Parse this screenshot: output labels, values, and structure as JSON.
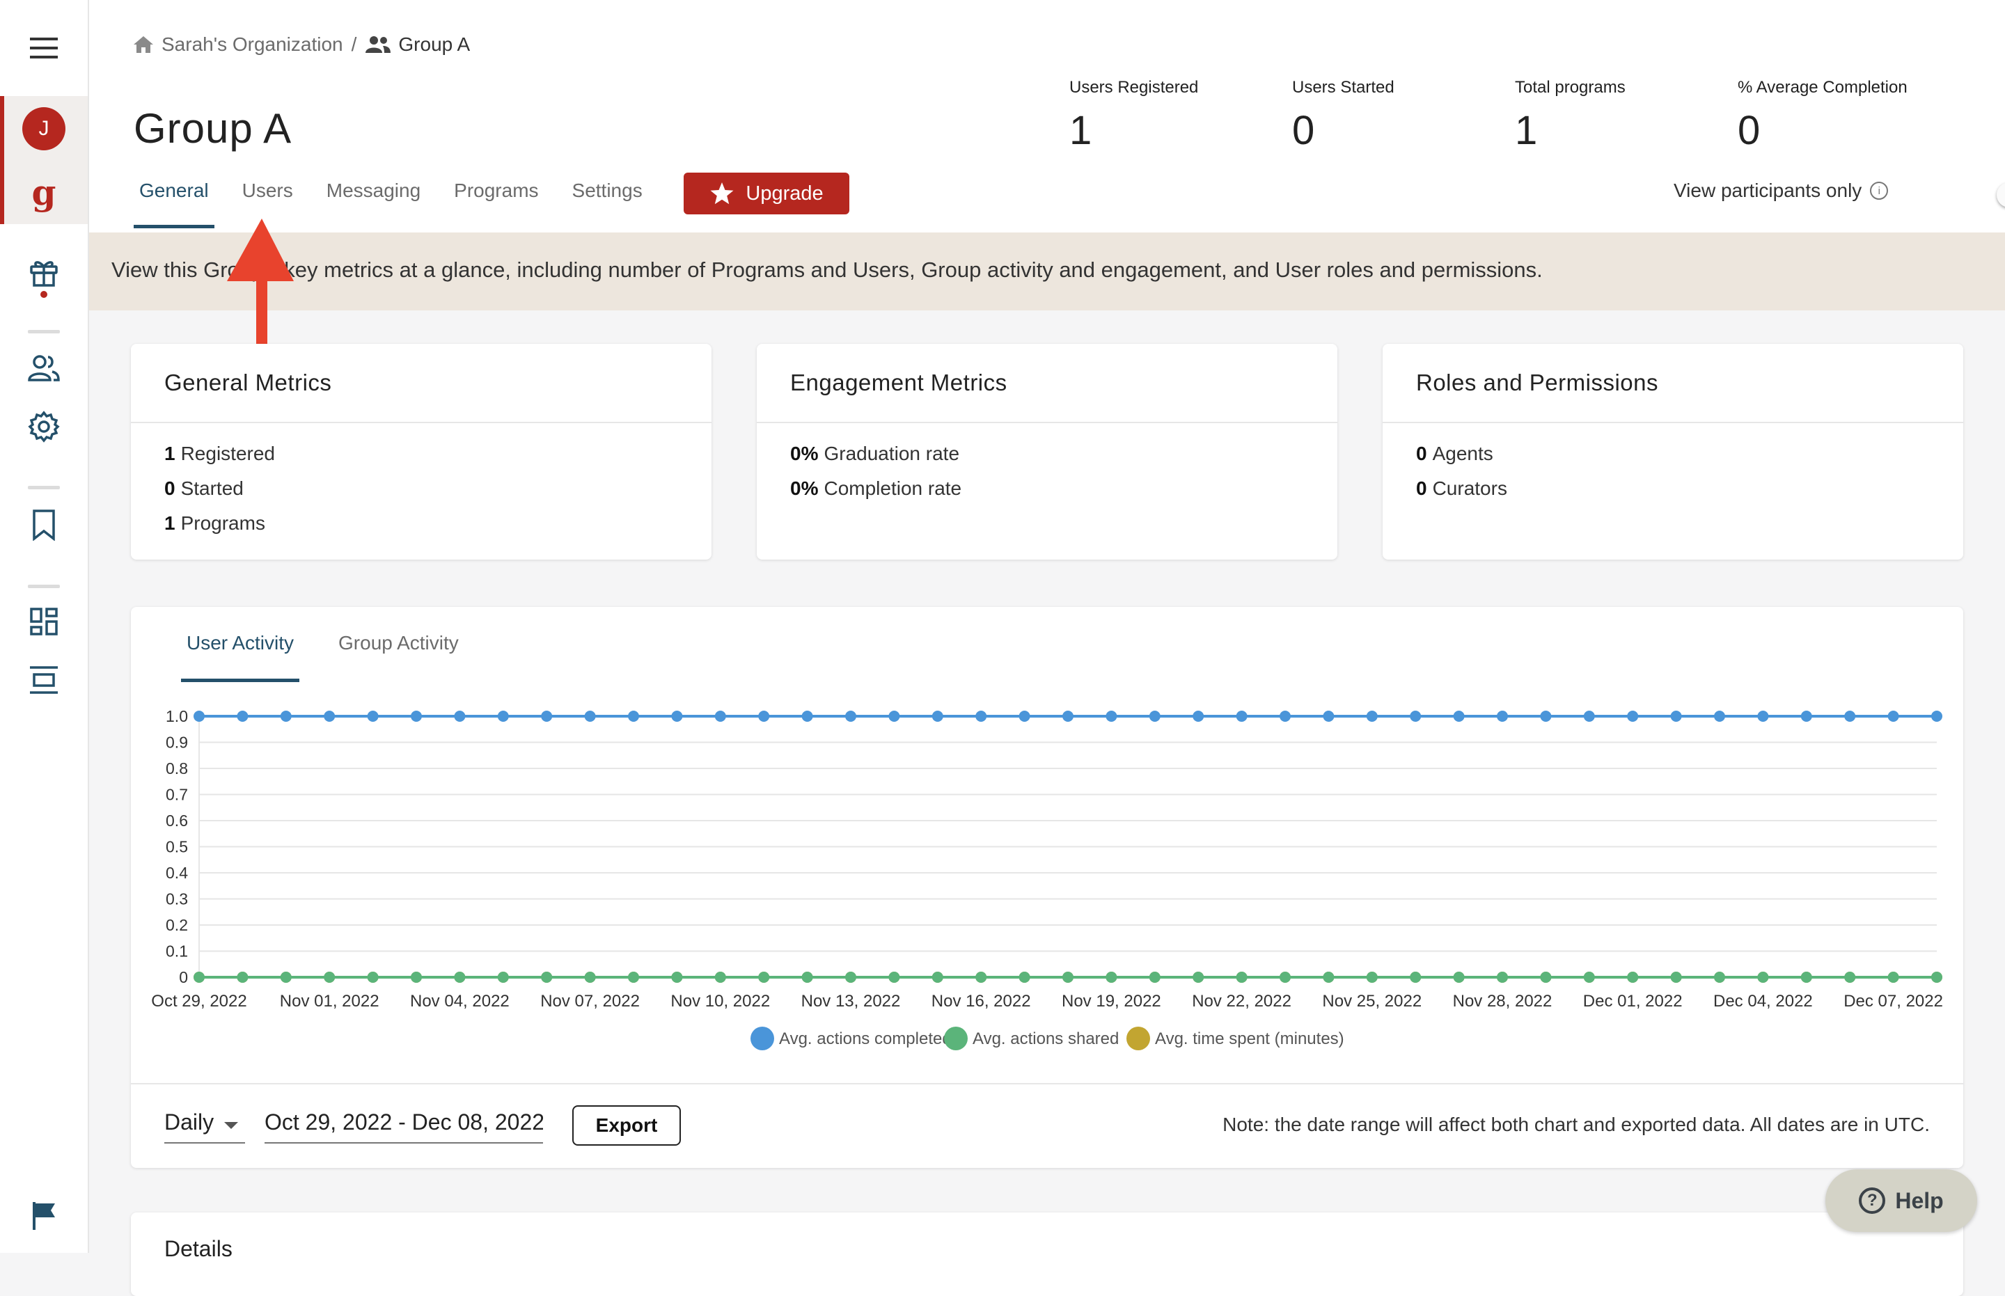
{
  "breadcrumb": {
    "org": "Sarah's Organization",
    "separator": "/",
    "group": "Group A"
  },
  "page_title": "Group A",
  "stats": [
    {
      "label": "Users Registered",
      "value": "1"
    },
    {
      "label": "Users Started",
      "value": "0"
    },
    {
      "label": "Total programs",
      "value": "1"
    },
    {
      "label": "% Average Completion",
      "value": "0"
    }
  ],
  "tabs": [
    "General",
    "Users",
    "Messaging",
    "Programs",
    "Settings"
  ],
  "active_tab": "General",
  "upgrade_label": "Upgrade",
  "view_participants_label": "View participants only",
  "view_participants_on": false,
  "avatar_initial": "J",
  "brand_letter": "g",
  "banner_text": "View this Group's key metrics at a glance, including number of Programs and Users, Group activity and engagement, and User roles and permissions.",
  "cards": {
    "general": {
      "title": "General Metrics",
      "lines": [
        {
          "value": "1",
          "label": "Registered"
        },
        {
          "value": "0",
          "label": "Started"
        },
        {
          "value": "1",
          "label": "Programs"
        }
      ]
    },
    "engagement": {
      "title": "Engagement Metrics",
      "lines": [
        {
          "value": "0%",
          "label": "Graduation rate"
        },
        {
          "value": "0%",
          "label": "Completion rate"
        }
      ]
    },
    "roles": {
      "title": "Roles and Permissions",
      "lines": [
        {
          "value": "0",
          "label": "Agents"
        },
        {
          "value": "0",
          "label": "Curators"
        }
      ]
    }
  },
  "activity_tabs": [
    "User Activity",
    "Group Activity"
  ],
  "chart_data": {
    "type": "line",
    "title": "",
    "xlabel": "",
    "ylabel": "",
    "ylim": [
      0,
      1.0
    ],
    "yticks": [
      "1.0",
      "0.9",
      "0.8",
      "0.7",
      "0.6",
      "0.5",
      "0.4",
      "0.3",
      "0.2",
      "0.1",
      "0"
    ],
    "x_tick_labels": [
      "Oct 29, 2022",
      "Nov 01, 2022",
      "Nov 04, 2022",
      "Nov 07, 2022",
      "Nov 10, 2022",
      "Nov 13, 2022",
      "Nov 16, 2022",
      "Nov 19, 2022",
      "Nov 22, 2022",
      "Nov 25, 2022",
      "Nov 28, 2022",
      "Dec 01, 2022",
      "Dec 04, 2022",
      "Dec 07, 2022"
    ],
    "x": [
      "Oct 29, 2022",
      "Oct 30, 2022",
      "Oct 31, 2022",
      "Nov 01, 2022",
      "Nov 02, 2022",
      "Nov 03, 2022",
      "Nov 04, 2022",
      "Nov 05, 2022",
      "Nov 06, 2022",
      "Nov 07, 2022",
      "Nov 08, 2022",
      "Nov 09, 2022",
      "Nov 10, 2022",
      "Nov 11, 2022",
      "Nov 12, 2022",
      "Nov 13, 2022",
      "Nov 14, 2022",
      "Nov 15, 2022",
      "Nov 16, 2022",
      "Nov 17, 2022",
      "Nov 18, 2022",
      "Nov 19, 2022",
      "Nov 20, 2022",
      "Nov 21, 2022",
      "Nov 22, 2022",
      "Nov 23, 2022",
      "Nov 24, 2022",
      "Nov 25, 2022",
      "Nov 26, 2022",
      "Nov 27, 2022",
      "Nov 28, 2022",
      "Nov 29, 2022",
      "Nov 30, 2022",
      "Dec 01, 2022",
      "Dec 02, 2022",
      "Dec 03, 2022",
      "Dec 04, 2022",
      "Dec 05, 2022",
      "Dec 06, 2022",
      "Dec 07, 2022",
      "Dec 08, 2022"
    ],
    "series": [
      {
        "name": "Avg. actions completed",
        "color": "#4a95d9",
        "value_all": 1
      },
      {
        "name": "Avg. actions shared",
        "color": "#5bb47a",
        "value_all": 0
      },
      {
        "name": "Avg. time spent (minutes)",
        "color": "#c2a531",
        "value_all": 0
      }
    ],
    "legend_position": "bottom",
    "grid": true
  },
  "period": "Daily",
  "date_range": "Oct 29, 2022 - Dec 08, 2022",
  "export_label": "Export",
  "note": "Note: the date range will affect both chart and exported data. All dates are in UTC.",
  "details_title": "Details",
  "help_label": "Help",
  "help_glyph": "?",
  "colors": {
    "accent": "#b5271f",
    "tab_active": "#24506a",
    "banner": "#ede6dd"
  }
}
